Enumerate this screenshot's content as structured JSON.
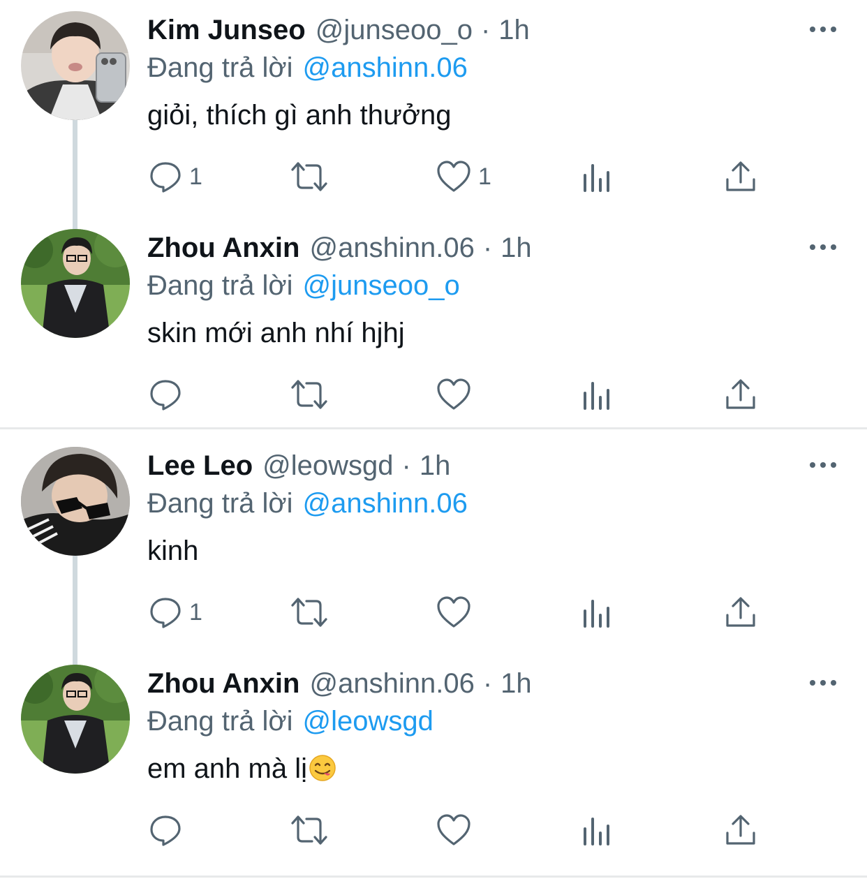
{
  "reply_prefix": "Đang trả lời",
  "colors": {
    "link": "#1d9bf0",
    "muted": "#536471",
    "text": "#0f1419",
    "thread_line": "#cfd9de"
  },
  "tweets": [
    {
      "name": "Kim Junseo",
      "handle": "@junseoo_o",
      "separator": "·",
      "time": "1h",
      "reply_to": "@anshinn.06",
      "text": "giỏi, thích gì anh thưởng",
      "emoji": "",
      "reply_count": "1",
      "retweet_count": "",
      "like_count": "1",
      "avatar_icon": "avatar-kim-junseo"
    },
    {
      "name": "Zhou Anxin",
      "handle": "@anshinn.06",
      "separator": "·",
      "time": "1h",
      "reply_to": "@junseoo_o",
      "text": "skin mới anh nhí hjhj",
      "emoji": "",
      "reply_count": "",
      "retweet_count": "",
      "like_count": "",
      "avatar_icon": "avatar-zhou-anxin"
    },
    {
      "name": "Lee Leo",
      "handle": "@leowsgd",
      "separator": "·",
      "time": "1h",
      "reply_to": "@anshinn.06",
      "text": "kinh",
      "emoji": "",
      "reply_count": "1",
      "retweet_count": "",
      "like_count": "",
      "avatar_icon": "avatar-lee-leo"
    },
    {
      "name": "Zhou Anxin",
      "handle": "@anshinn.06",
      "separator": "·",
      "time": "1h",
      "reply_to": "@leowsgd",
      "text": "em anh mà lị",
      "emoji": "face-savoring-food",
      "reply_count": "",
      "retweet_count": "",
      "like_count": "",
      "avatar_icon": "avatar-zhou-anxin"
    }
  ]
}
